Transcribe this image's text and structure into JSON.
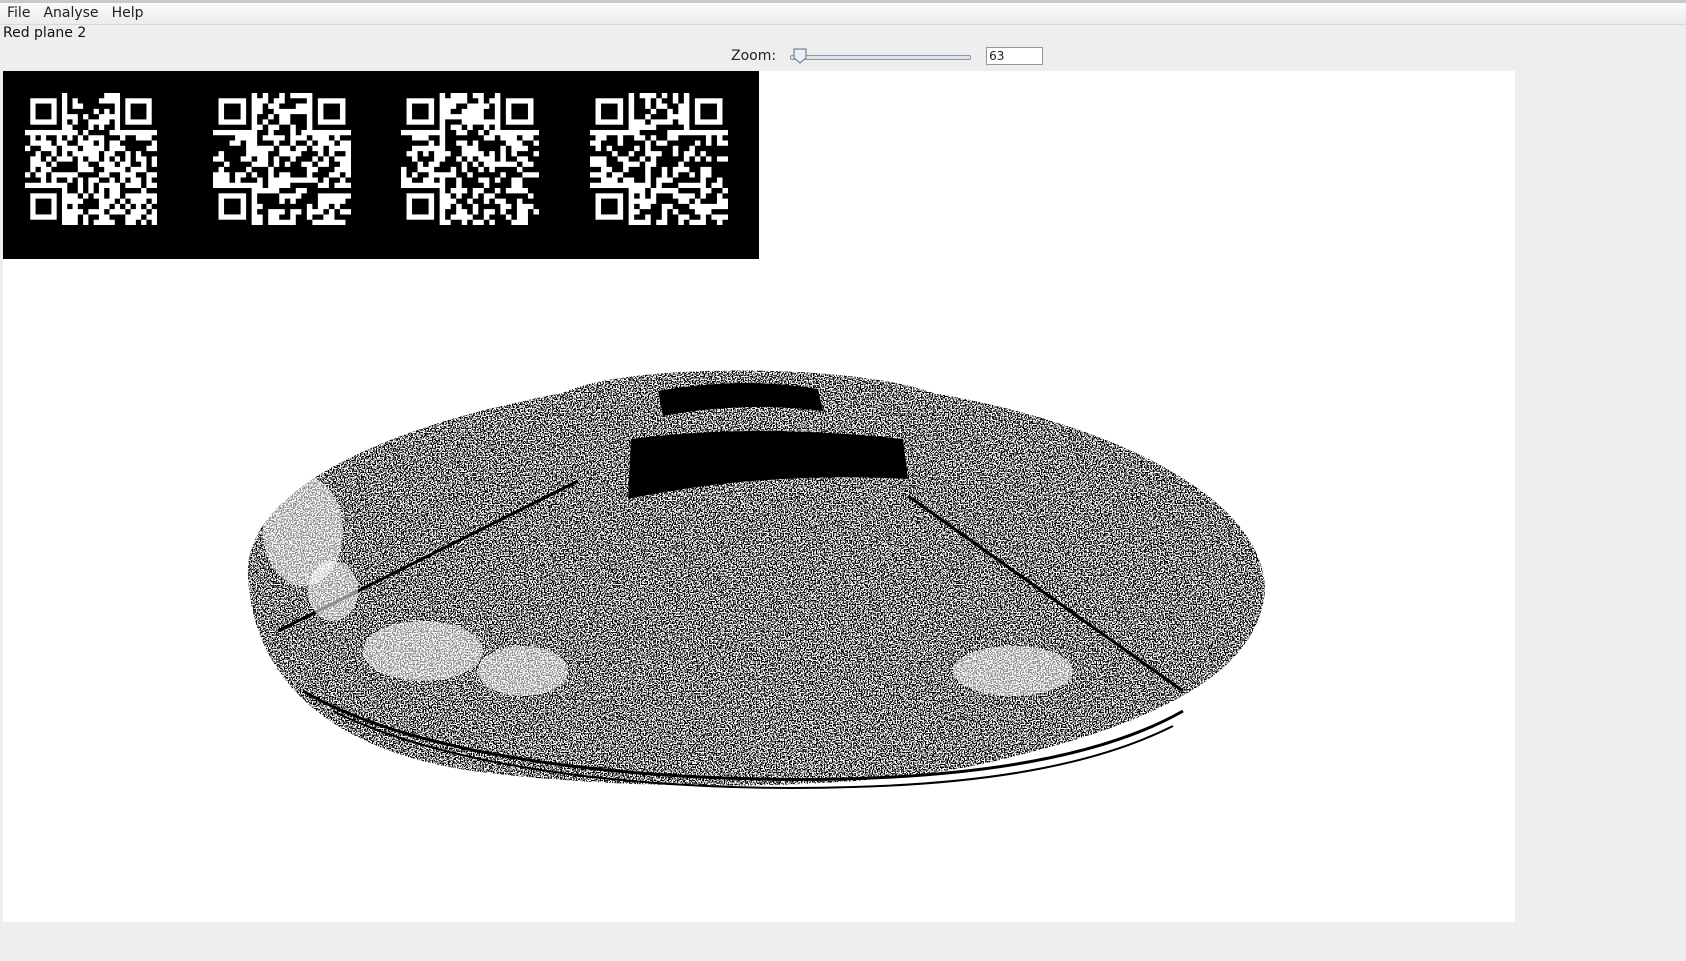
{
  "menu": {
    "items": [
      "File",
      "Analyse",
      "Help"
    ]
  },
  "view": {
    "plane_label": "Red plane 2"
  },
  "zoom": {
    "label": "Zoom:",
    "value": "63",
    "slider_fraction": 0.03
  },
  "image": {
    "qr_codes": [
      {
        "name": "qr-code-1"
      },
      {
        "name": "qr-code-2"
      },
      {
        "name": "qr-code-3"
      },
      {
        "name": "qr-code-4"
      }
    ],
    "colors": {
      "foreground": "#000000",
      "background": "#ffffff"
    }
  }
}
